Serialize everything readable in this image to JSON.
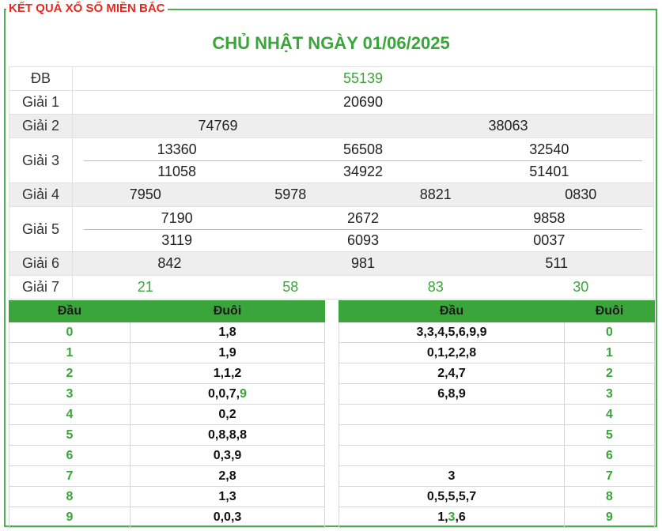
{
  "header": {
    "legend": "KẾT QUẢ XỔ SỐ MIỀN BẮC",
    "title": "CHỦ NHẬT NGÀY 01/06/2025"
  },
  "prizes": {
    "db": {
      "label": "ĐB",
      "values": [
        "55139"
      ]
    },
    "g1": {
      "label": "Giải 1",
      "values": [
        "20690"
      ]
    },
    "g2": {
      "label": "Giải 2",
      "values": [
        "74769",
        "38063"
      ]
    },
    "g3": {
      "label": "Giải 3",
      "values": [
        "13360",
        "56508",
        "32540",
        "11058",
        "34922",
        "51401"
      ]
    },
    "g4": {
      "label": "Giải 4",
      "values": [
        "7950",
        "5978",
        "8821",
        "0830"
      ]
    },
    "g5": {
      "label": "Giải 5",
      "values": [
        "7190",
        "2672",
        "9858",
        "3119",
        "6093",
        "0037"
      ]
    },
    "g6": {
      "label": "Giải 6",
      "values": [
        "842",
        "981",
        "511"
      ]
    },
    "g7": {
      "label": "Giải 7",
      "values": [
        "21",
        "58",
        "83",
        "30"
      ]
    }
  },
  "dau_table": {
    "headers": [
      "Đầu",
      "Đuôi"
    ],
    "rows": [
      {
        "dau": "0",
        "duoi": "1,8",
        "hl": ""
      },
      {
        "dau": "1",
        "duoi": "1,9",
        "hl": ""
      },
      {
        "dau": "2",
        "duoi": "1,1,2",
        "hl": ""
      },
      {
        "dau": "3",
        "duoi": "0,0,7,",
        "hl": "9"
      },
      {
        "dau": "4",
        "duoi": "0,2",
        "hl": ""
      },
      {
        "dau": "5",
        "duoi": "0,8,8,8",
        "hl": ""
      },
      {
        "dau": "6",
        "duoi": "0,3,9",
        "hl": ""
      },
      {
        "dau": "7",
        "duoi": "2,8",
        "hl": ""
      },
      {
        "dau": "8",
        "duoi": "1,3",
        "hl": ""
      },
      {
        "dau": "9",
        "duoi": "0,0,3",
        "hl": ""
      }
    ]
  },
  "duoi_table": {
    "headers": [
      "Đầu",
      "Đuôi"
    ],
    "rows": [
      {
        "dau": "3,3,4,5,6,9,9",
        "duoi": "0"
      },
      {
        "dau": "0,1,2,2,8",
        "duoi": "1"
      },
      {
        "dau": "2,4,7",
        "duoi": "2"
      },
      {
        "dau": "6,8,9",
        "duoi": "3"
      },
      {
        "dau": "",
        "duoi": "4"
      },
      {
        "dau": "",
        "duoi": "5"
      },
      {
        "dau": "",
        "duoi": "6"
      },
      {
        "dau": "3",
        "duoi": "7"
      },
      {
        "dau": "0,5,5,5,7",
        "duoi": "8"
      },
      {
        "dau": "1,3,6",
        "duoi": "9"
      }
    ],
    "row9_parts": [
      "1,",
      "3",
      ",6"
    ]
  },
  "colors": {
    "accent": "#3aa53a",
    "legend": "#e8281e",
    "row_gray": "#eeeeee"
  }
}
